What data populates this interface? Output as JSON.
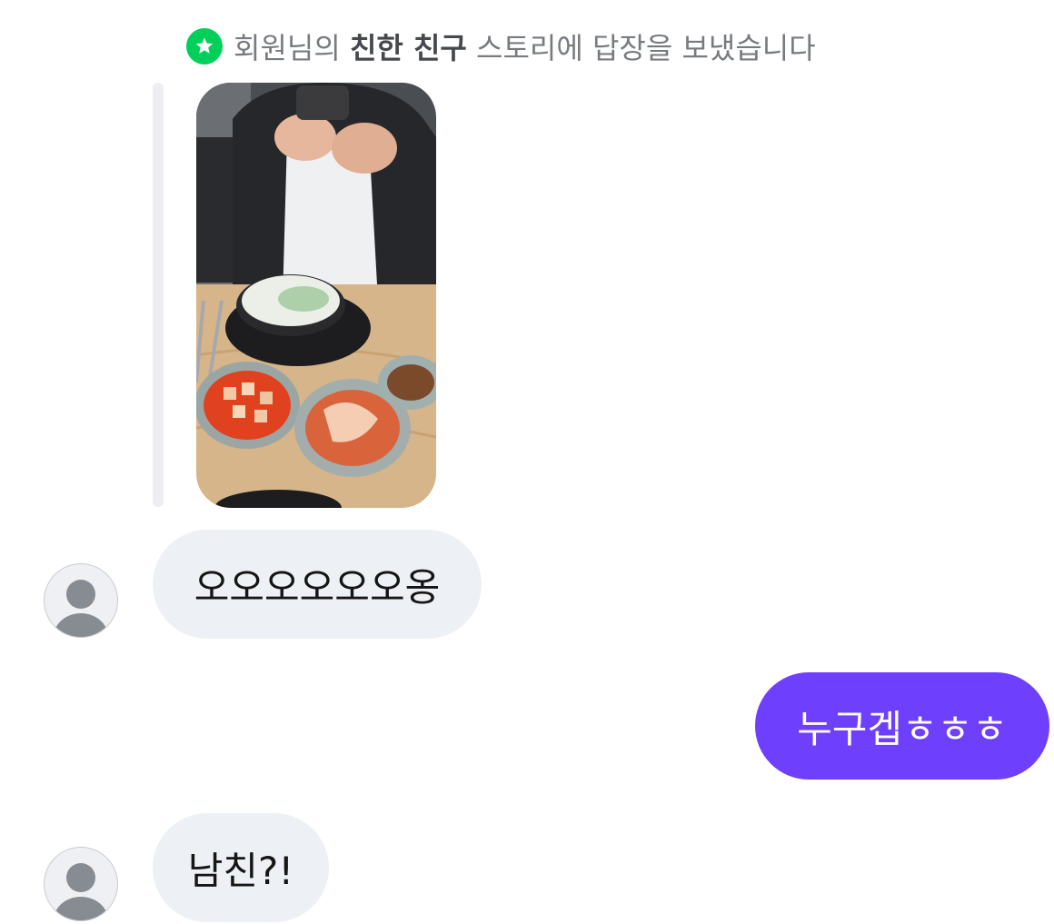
{
  "story_reply": {
    "icon": "star-icon",
    "text_prefix": "회원님의 ",
    "text_bold": "친한 친구",
    "text_suffix": " 스토리에 답장을 보냈습니다"
  },
  "story_photo": {
    "icon": "food-photo"
  },
  "messages": [
    {
      "sender": "friend",
      "text": "오오오오오오옹"
    },
    {
      "sender": "me",
      "text": "누구겝ㅎㅎㅎ"
    },
    {
      "sender": "friend",
      "text": "남친?!"
    }
  ],
  "colors": {
    "accent_green": "#00d05a",
    "outgoing_bubble": "#6e3ffc",
    "incoming_bubble": "#edf0f4",
    "header_text": "#777b80"
  }
}
